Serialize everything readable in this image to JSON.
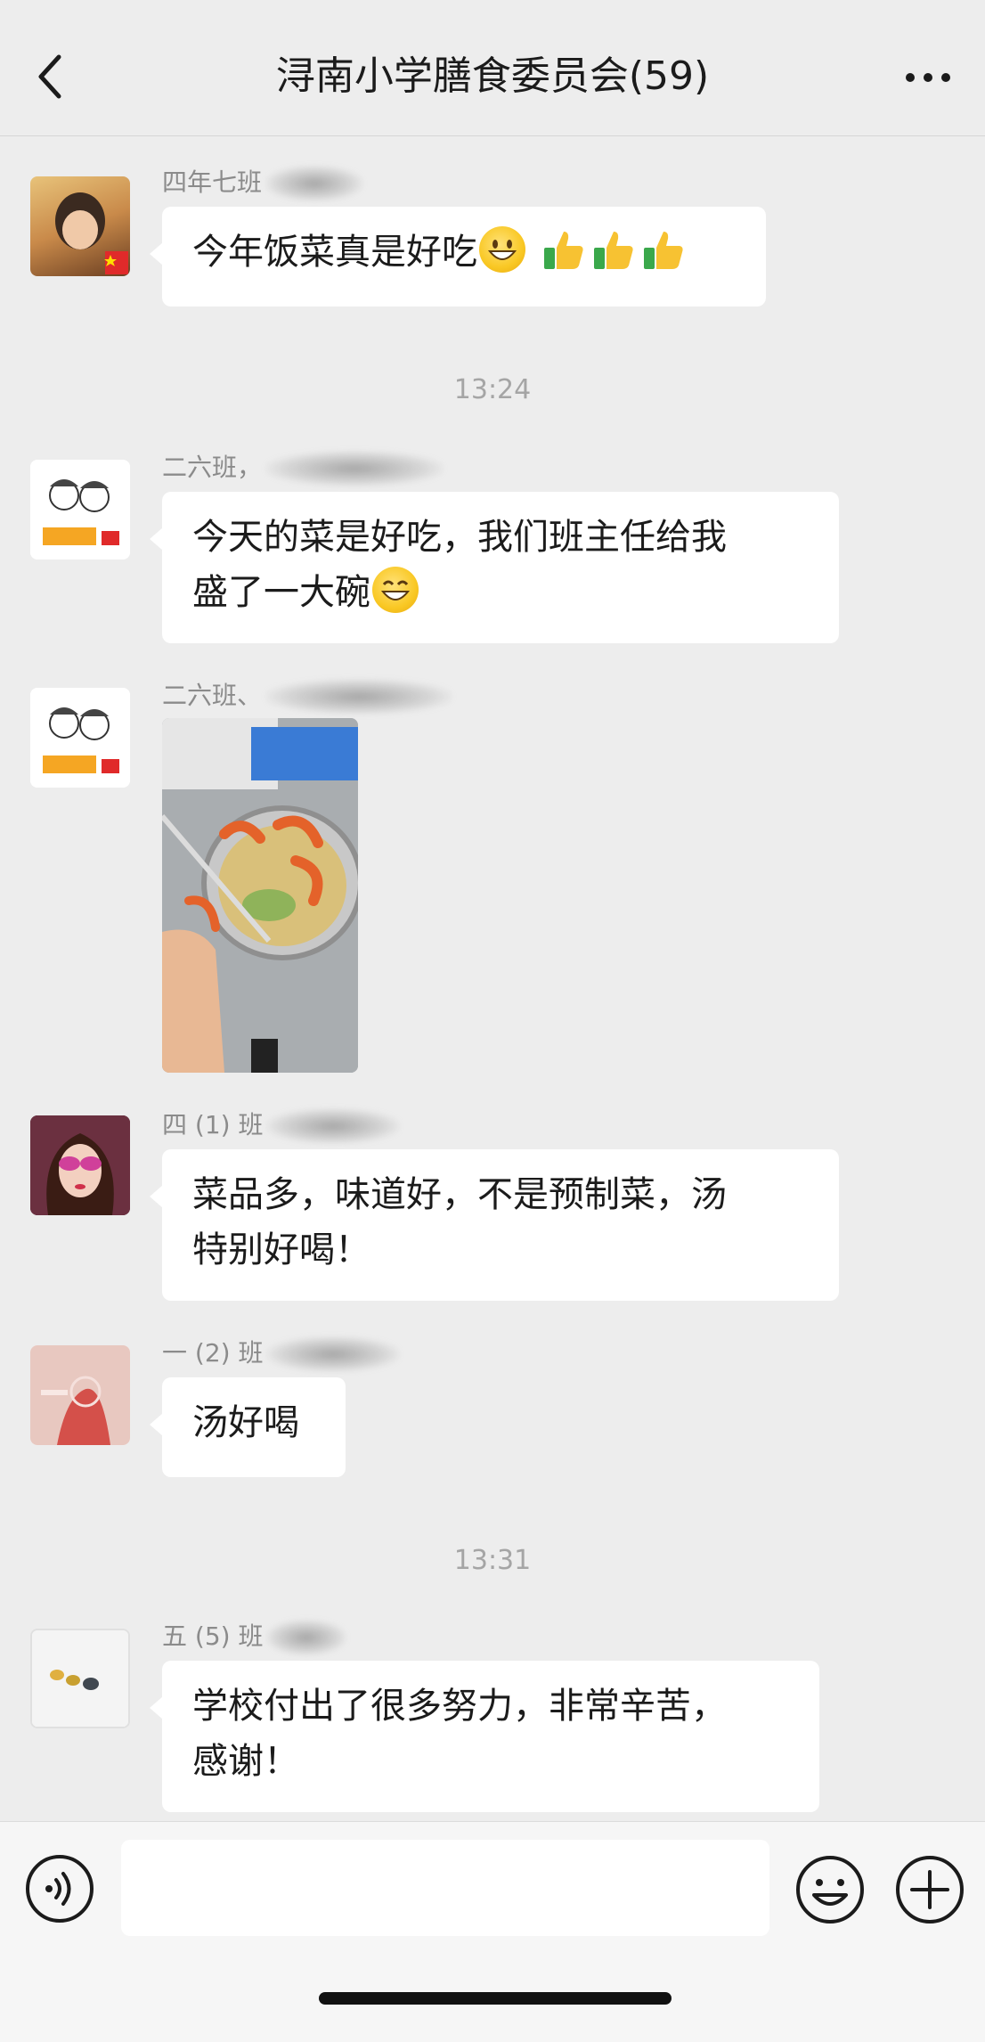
{
  "header": {
    "title": "浔南小学膳食委员会(59)",
    "back_icon": "chevron-left-icon",
    "more_icon": "ellipsis-icon"
  },
  "messages": [
    {
      "sender": "四年七班",
      "text": "今年饭菜真是好吃",
      "emoji": [
        "grinning-face",
        "thumbs-up",
        "thumbs-up",
        "thumbs-up"
      ]
    },
    {
      "sender": "二六班，",
      "text_line1": "今天的菜是好吃，我们班主任给我",
      "text_line2": "盛了一大碗",
      "emoji": [
        "smiling-face"
      ]
    },
    {
      "sender": "二六班、",
      "image": "photo-bowl-of-shrimp-and-vegetables"
    },
    {
      "sender": "四 (1) 班",
      "text_line1": "菜品多，味道好，不是预制菜，汤",
      "text_line2": "特别好喝！"
    },
    {
      "sender": "一 (2) 班",
      "text": "汤好喝"
    },
    {
      "sender": "五 (5) 班",
      "text_line1": "学校付出了很多努力，非常辛苦，",
      "text_line2": "感谢！"
    }
  ],
  "timestamps": [
    "13:24",
    "13:31"
  ],
  "input_bar": {
    "voice_icon": "voice-icon",
    "text_value": "",
    "emoji_icon": "smile-icon",
    "plus_icon": "plus-circle-icon"
  },
  "colors": {
    "background": "#ededed",
    "bubble": "#ffffff",
    "timestamp": "#a5a5a5",
    "sender": "#8b8b8b"
  }
}
